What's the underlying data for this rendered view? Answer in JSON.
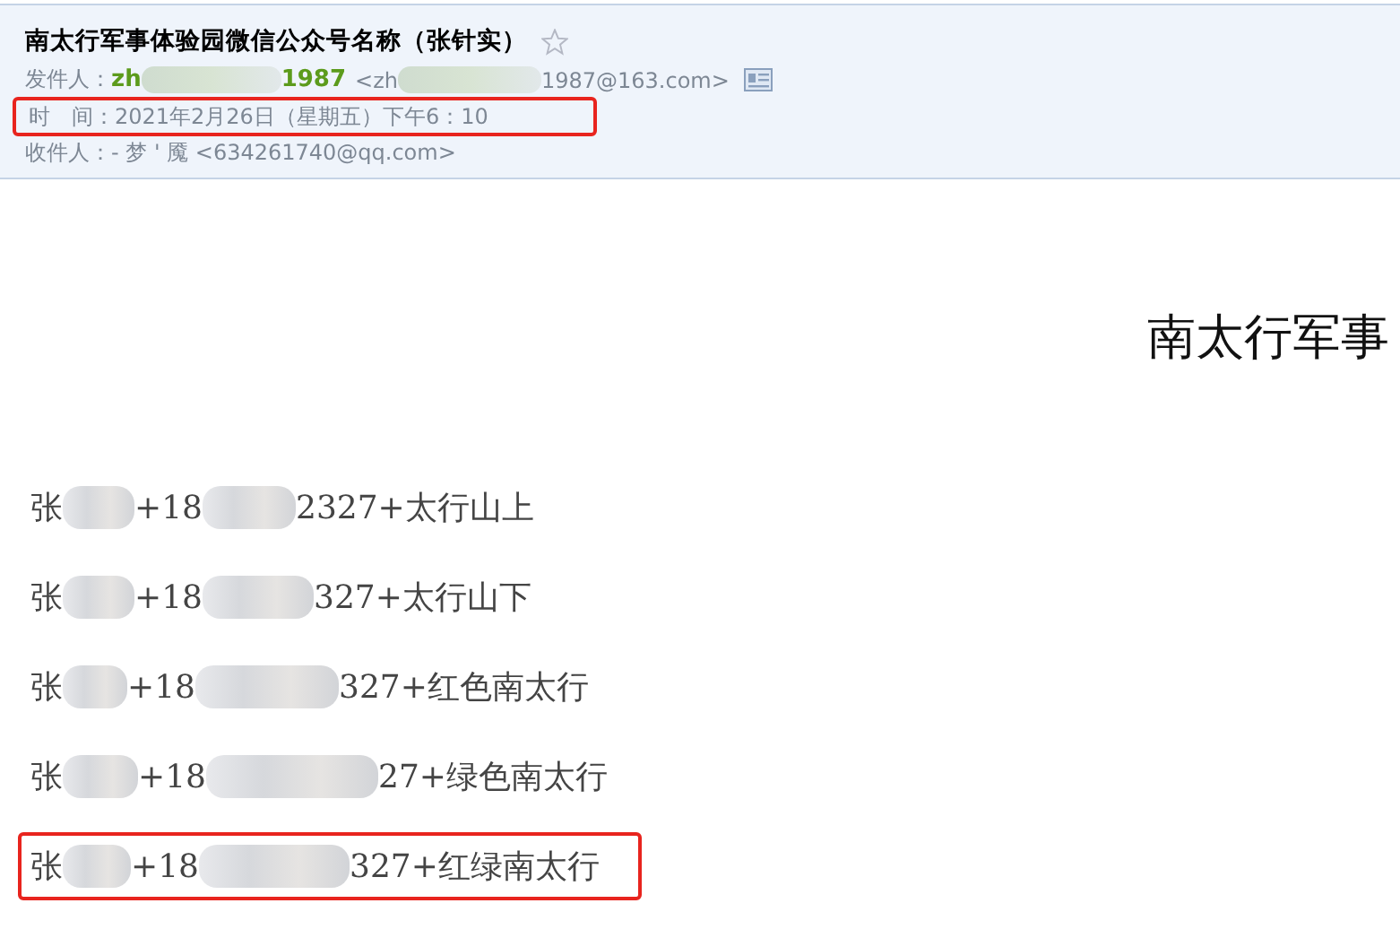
{
  "email": {
    "subject": "南太行军事体验园微信公众号名称（张针实）",
    "starred": false,
    "sender": {
      "label": "发件人：",
      "name_parts": [
        {
          "kind": "text",
          "text": "zh"
        },
        {
          "kind": "blur"
        },
        {
          "kind": "text",
          "text": "1987"
        }
      ],
      "address_parts": [
        {
          "kind": "text",
          "text": "<zh"
        },
        {
          "kind": "blur"
        },
        {
          "kind": "text",
          "text": "1987@163.com>"
        }
      ]
    },
    "time": {
      "label": "时　间：",
      "value": "2021年2月26日（星期五）下午6：10",
      "highlighted": true
    },
    "recipient": {
      "label": "收件人：",
      "value": "- 梦 ' 魇 <634261740@qq.com>"
    }
  },
  "body": {
    "heading": "南太行军事",
    "lines": [
      {
        "highlighted": false,
        "parts": [
          {
            "kind": "text",
            "text": "张"
          },
          {
            "kind": "blur"
          },
          {
            "kind": "text",
            "text": "+18"
          },
          {
            "kind": "blur"
          },
          {
            "kind": "text",
            "text": "2327+太行山上"
          }
        ]
      },
      {
        "highlighted": false,
        "parts": [
          {
            "kind": "text",
            "text": "张"
          },
          {
            "kind": "blur"
          },
          {
            "kind": "text",
            "text": "+18"
          },
          {
            "kind": "blur"
          },
          {
            "kind": "text",
            "text": "327+太行山下"
          }
        ]
      },
      {
        "highlighted": false,
        "parts": [
          {
            "kind": "text",
            "text": "张"
          },
          {
            "kind": "blur"
          },
          {
            "kind": "text",
            "text": "+18"
          },
          {
            "kind": "blur"
          },
          {
            "kind": "text",
            "text": "327+红色南太行"
          }
        ]
      },
      {
        "highlighted": false,
        "parts": [
          {
            "kind": "text",
            "text": "张"
          },
          {
            "kind": "blur"
          },
          {
            "kind": "text",
            "text": "+18"
          },
          {
            "kind": "blur"
          },
          {
            "kind": "text",
            "text": "27+绿色南太行"
          }
        ]
      },
      {
        "highlighted": true,
        "parts": [
          {
            "kind": "text",
            "text": "张"
          },
          {
            "kind": "blur"
          },
          {
            "kind": "text",
            "text": "+18"
          },
          {
            "kind": "blur"
          },
          {
            "kind": "text",
            "text": "327+红绿南太行"
          }
        ]
      }
    ]
  }
}
